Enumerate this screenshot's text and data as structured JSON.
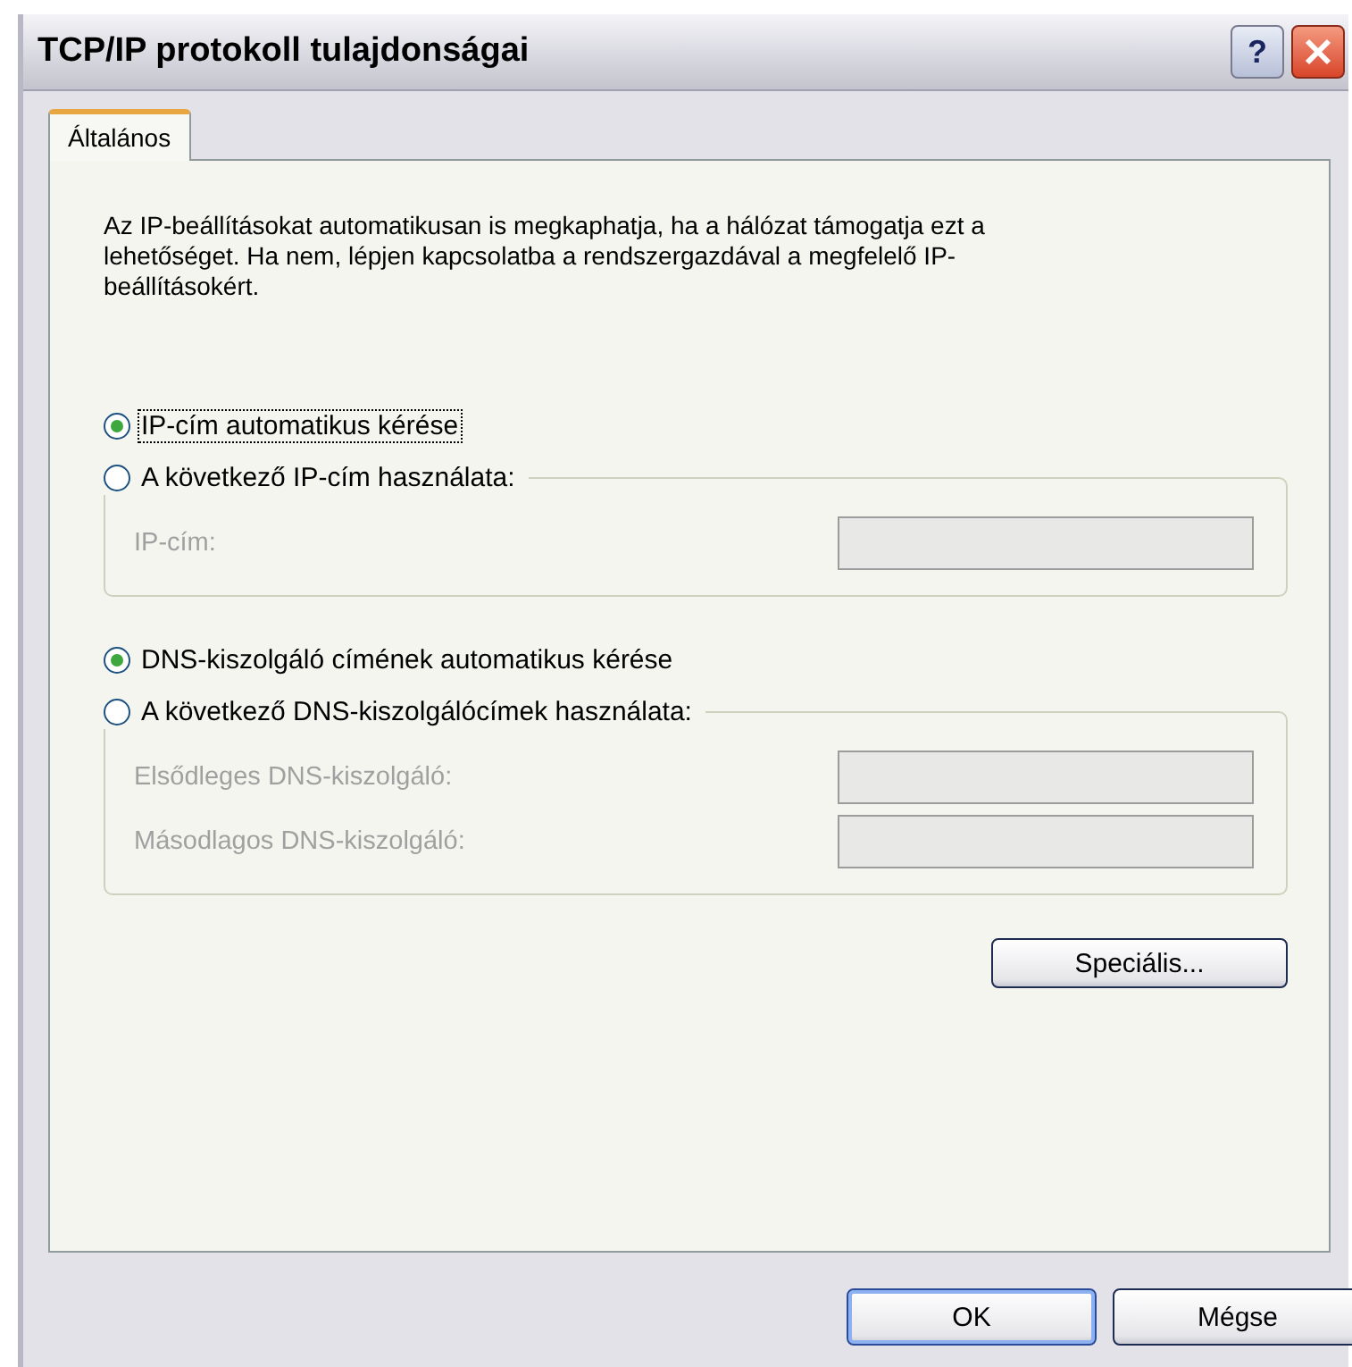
{
  "window": {
    "title": "TCP/IP protokoll tulajdonságai",
    "help": "?"
  },
  "tabs": [
    {
      "label": "Általános",
      "selected": true
    }
  ],
  "description": "Az IP-beállításokat automatikusan is megkaphatja, ha a hálózat támogatja ezt a lehetőséget. Ha nem, lépjen kapcsolatba a rendszergazdával a megfelelő IP-beállításokért.",
  "sections": [
    {
      "auto_option": {
        "label": "IP-cím automatikus kérése",
        "selected": true,
        "focused": true
      },
      "manual_option": {
        "label": "A következő IP-cím használata:",
        "selected": false
      },
      "fields": [
        {
          "label": "IP-cím:",
          "disabled": true
        }
      ]
    },
    {
      "auto_option": {
        "label": "DNS-kiszolgáló címének automatikus kérése",
        "selected": true,
        "focused": false
      },
      "manual_option": {
        "label": "A következő DNS-kiszolgálócímek használata:",
        "selected": false
      },
      "fields": [
        {
          "label": "Elsődleges DNS-kiszolgáló:",
          "disabled": true
        },
        {
          "label": "Másodlagos DNS-kiszolgáló:",
          "disabled": true
        }
      ]
    }
  ],
  "advanced_button": "Speciális...",
  "buttons": [
    {
      "label": "OK",
      "default": true
    },
    {
      "label": "Mégse",
      "default": false
    }
  ]
}
